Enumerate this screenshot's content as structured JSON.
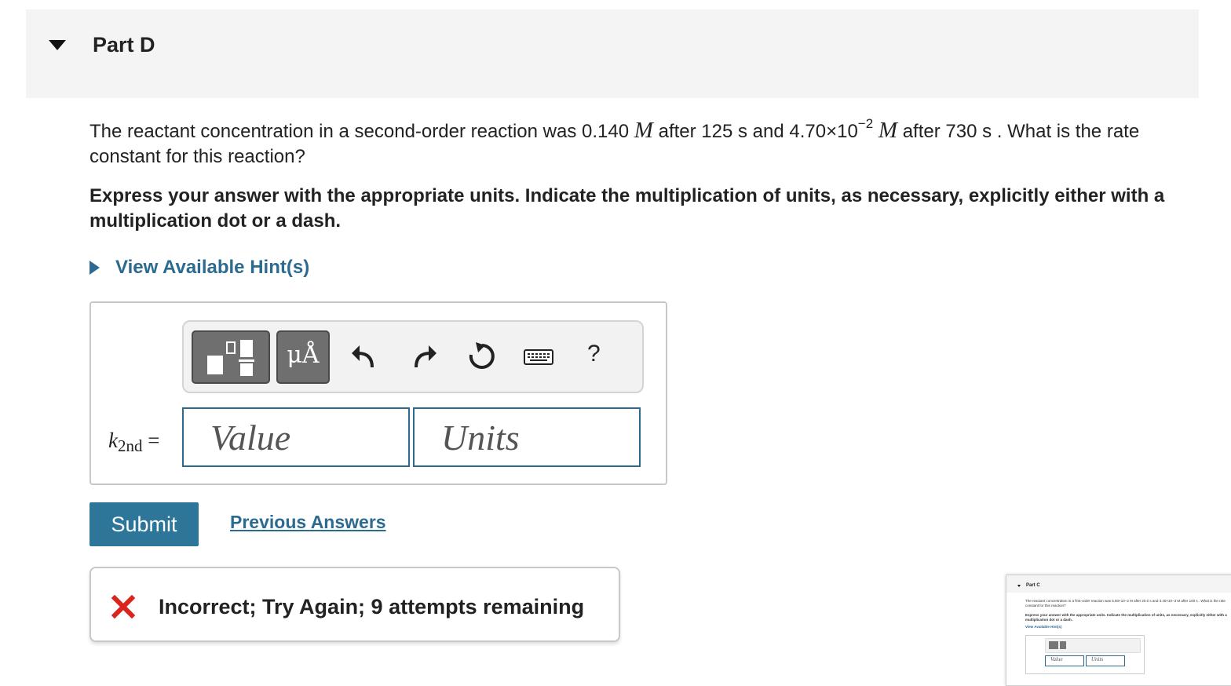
{
  "part": {
    "title": "Part D"
  },
  "question": {
    "text_1": "The reactant concentration in a second-order reaction was 0.140 ",
    "unit_m": "M",
    "text_2": " after 125 s and 4.70×10",
    "exponent": "−2",
    "text_3": " after 730 s . What is the rate constant for this reaction?"
  },
  "instruction": "Express your answer with the appropriate units. Indicate the multiplication of units, as necessary, explicitly either with a multiplication dot or a dash.",
  "hint": {
    "label": "View Available Hint(s)"
  },
  "toolbar": {
    "units_label": "μÅ",
    "help_label": "?",
    "icons": [
      "templates-icon",
      "undo-icon",
      "redo-icon",
      "reset-icon",
      "keyboard-icon",
      "help-icon"
    ]
  },
  "answer": {
    "variable": "k",
    "subscript": "2nd",
    "equals": "=",
    "value_placeholder": "Value",
    "units_placeholder": "Units"
  },
  "actions": {
    "submit_label": "Submit",
    "previous_label": "Previous Answers"
  },
  "feedback": {
    "text": "Incorrect; Try Again; 9 attempts remaining",
    "status_color": "#d9251d"
  },
  "colors": {
    "accent": "#2d6a90",
    "submit_bg": "#2d7599"
  },
  "thumbnail": {
    "title": "Part C",
    "question": "The reactant concentration in a first-order reaction was 5.50×10−2 M after 20.0 s and 3.40×10−3 M after 100 s . What is the rate constant for this reaction?",
    "instruction": "Express your answer with the appropriate units. Indicate the multiplication of units, as necessary, explicitly either with a multiplication dot or a dash.",
    "hint": "View Available Hint(s)",
    "value_placeholder": "Value",
    "units_placeholder": "Units"
  }
}
